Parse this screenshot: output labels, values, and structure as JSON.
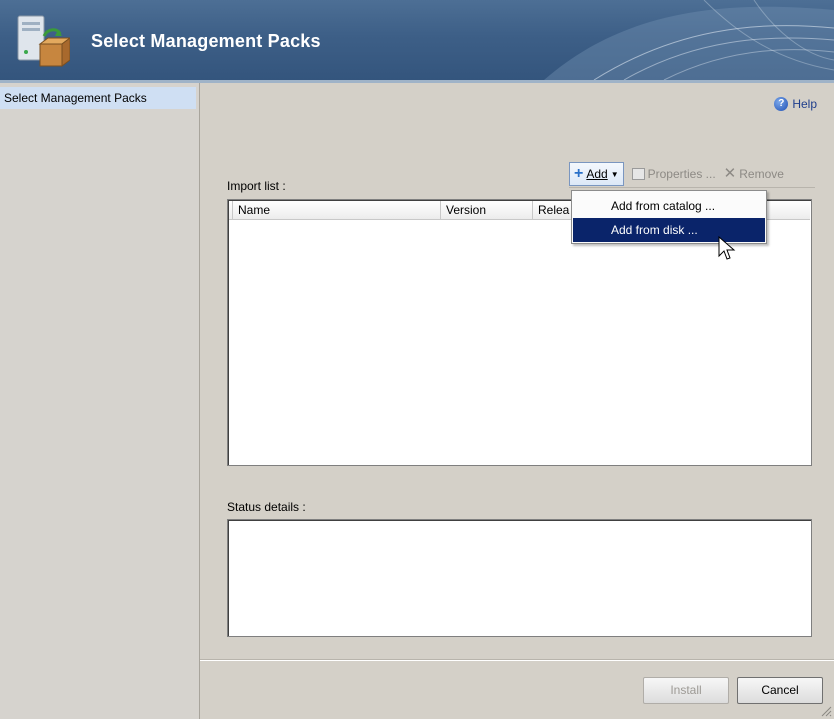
{
  "header": {
    "title": "Select Management Packs"
  },
  "nav": {
    "items": [
      {
        "label": "Select Management Packs"
      }
    ]
  },
  "help": {
    "label": "Help"
  },
  "import_list": {
    "label": "Import list :",
    "columns": [
      "Name",
      "Version",
      "Relea"
    ]
  },
  "toolbar": {
    "add_label": "Add",
    "properties_label": "Properties ...",
    "remove_label": "Remove"
  },
  "add_menu": {
    "items": [
      "Add from catalog ...",
      "Add from disk ..."
    ],
    "selected": "Add from disk ..."
  },
  "status": {
    "label": "Status details :"
  },
  "buttons": {
    "install_label": "Install",
    "cancel_label": "Cancel"
  },
  "icons": {
    "header": "management-pack-icon",
    "help": "help-icon",
    "add": "plus-icon",
    "properties": "properties-icon",
    "remove": "x-icon"
  },
  "colors": {
    "header": "#3d5f87",
    "selection": "#0a246a",
    "nav_highlight": "#cfdff3"
  }
}
